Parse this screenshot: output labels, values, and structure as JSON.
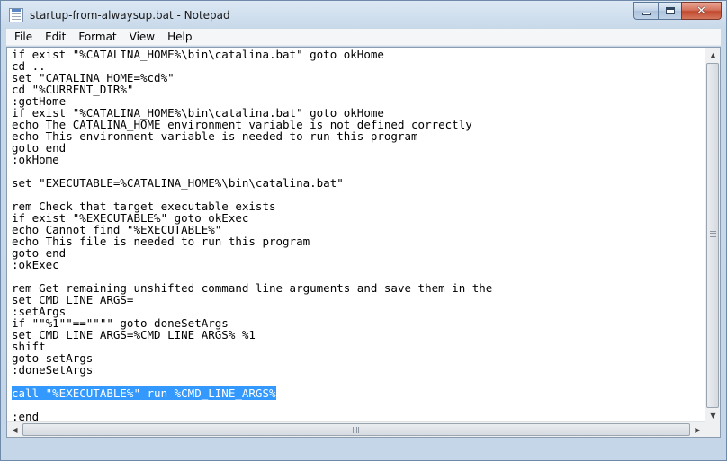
{
  "window": {
    "title": "startup-from-alwaysup.bat - Notepad",
    "controls": {
      "minimize": "minimize",
      "maximize": "maximize",
      "close": "✕"
    }
  },
  "menu": {
    "items": [
      "File",
      "Edit",
      "Format",
      "View",
      "Help"
    ]
  },
  "editor": {
    "lines": [
      "if exist \"%CATALINA_HOME%\\bin\\catalina.bat\" goto okHome",
      "cd ..",
      "set \"CATALINA_HOME=%cd%\"",
      "cd \"%CURRENT_DIR%\"",
      ":gotHome",
      "if exist \"%CATALINA_HOME%\\bin\\catalina.bat\" goto okHome",
      "echo The CATALINA_HOME environment variable is not defined correctly",
      "echo This environment variable is needed to run this program",
      "goto end",
      ":okHome",
      "",
      "set \"EXECUTABLE=%CATALINA_HOME%\\bin\\catalina.bat\"",
      "",
      "rem Check that target executable exists",
      "if exist \"%EXECUTABLE%\" goto okExec",
      "echo Cannot find \"%EXECUTABLE%\"",
      "echo This file is needed to run this program",
      "goto end",
      ":okExec",
      "",
      "rem Get remaining unshifted command line arguments and save them in the",
      "set CMD_LINE_ARGS=",
      ":setArgs",
      "if \"\"%1\"\"==\"\"\"\" goto doneSetArgs",
      "set CMD_LINE_ARGS=%CMD_LINE_ARGS% %1",
      "shift",
      "goto setArgs",
      ":doneSetArgs",
      "",
      "call \"%EXECUTABLE%\" run %CMD_LINE_ARGS%",
      "",
      ":end"
    ],
    "selected_line_index": 29,
    "selection_color": "#3399ff"
  },
  "scrollbars": {
    "up_arrow": "▲",
    "down_arrow": "▼",
    "left_arrow": "◀",
    "right_arrow": "▶"
  }
}
